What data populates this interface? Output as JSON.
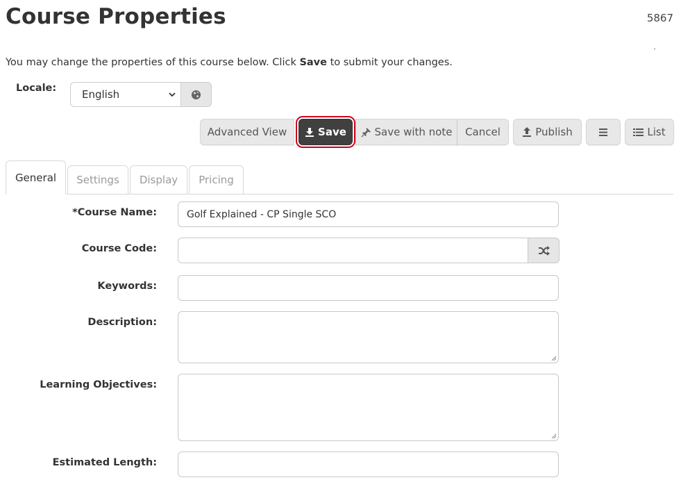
{
  "page": {
    "title": "Course Properties",
    "record_id": "5867",
    "corner_mark": "`",
    "intro_before": "You may change the properties of this course below. Click ",
    "intro_bold": "Save",
    "intro_after": " to submit your changes."
  },
  "locale": {
    "label": "Locale:",
    "selected": "English",
    "icons": {
      "caret": "chevron-down-icon",
      "button": "globe-icon"
    }
  },
  "toolbar": {
    "advanced_view": "Advanced View",
    "save": "Save",
    "save_with_note": "Save with note",
    "cancel": "Cancel",
    "publish": "Publish",
    "list": "List",
    "icons": {
      "save": "download-icon",
      "save_with_note": "pushpin-icon",
      "publish": "upload-icon",
      "menu": "hamburger-icon",
      "list": "list-icon"
    },
    "highlight_color": "#d0021b",
    "save_bg": "#404040"
  },
  "tabs": [
    {
      "label": "General",
      "active": true
    },
    {
      "label": "Settings",
      "active": false
    },
    {
      "label": "Display",
      "active": false
    },
    {
      "label": "Pricing",
      "active": false
    }
  ],
  "form": {
    "course_name": {
      "label": "*Course Name:",
      "value": "Golf Explained - CP Single SCO"
    },
    "course_code": {
      "label": "Course Code:",
      "value": "",
      "button_icon": "shuffle-icon"
    },
    "keywords": {
      "label": "Keywords:",
      "value": ""
    },
    "description": {
      "label": "Description:",
      "value": ""
    },
    "learning_objectives": {
      "label": "Learning Objectives:",
      "value": ""
    },
    "estimated_length": {
      "label": "Estimated Length:",
      "value": ""
    }
  }
}
